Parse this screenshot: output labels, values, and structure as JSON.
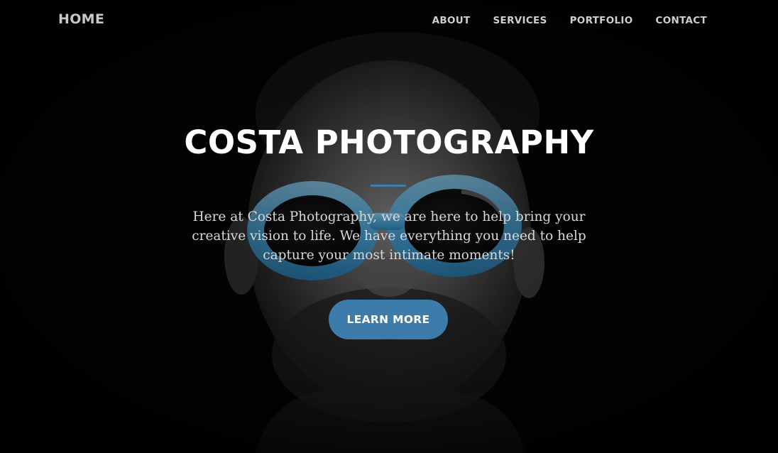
{
  "navbar": {
    "brand": "HOME",
    "links": [
      {
        "label": "ABOUT"
      },
      {
        "label": "SERVICES"
      },
      {
        "label": "PORTFOLIO"
      },
      {
        "label": "CONTACT"
      }
    ]
  },
  "hero": {
    "title": "COSTA PHOTOGRAPHY",
    "description": "Here at Costa Photography, we are here to help bring your creative vision to life. We have everything you need to help capture your most intimate moments!",
    "cta_label": "LEARN MORE"
  },
  "colors": {
    "accent": "#3d7caa",
    "glasses": "#5cb3e6",
    "background": "#000000",
    "title": "#ffffff",
    "nav_text": "#cfcfcf"
  },
  "icons": {
    "background_image": "portrait-man-blue-sunglasses"
  }
}
